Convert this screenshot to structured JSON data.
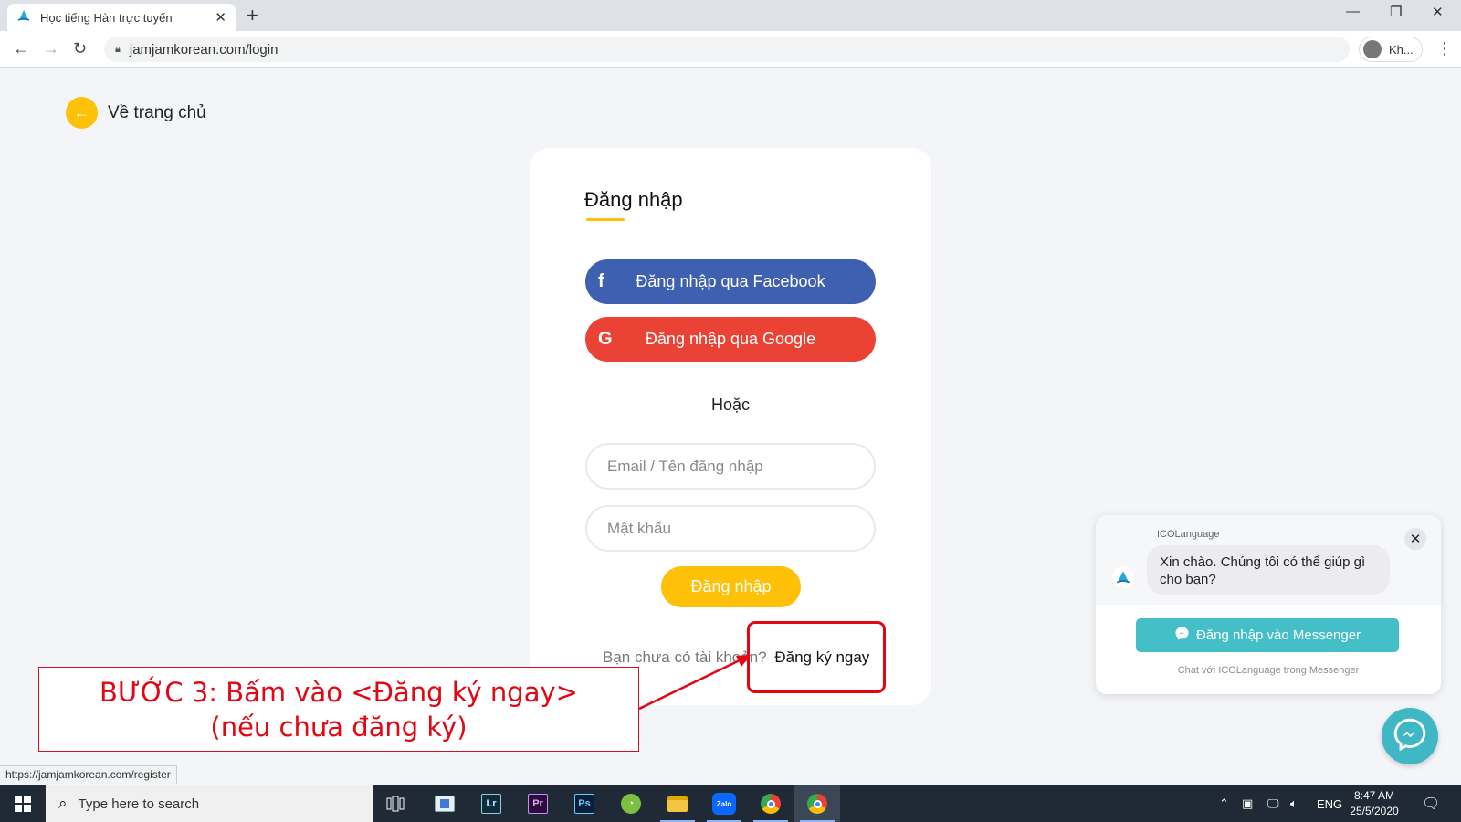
{
  "browser": {
    "tab_title": "Học tiếng Hàn trực tuyến",
    "url": "jamjamkorean.com/login",
    "profile_label": "Kh...",
    "status_url": "https://jamjamkorean.com/register"
  },
  "page": {
    "back_label": "Về trang chủ",
    "title": "Đăng nhập",
    "facebook_btn": "Đăng nhập qua Facebook",
    "google_btn": "Đăng nhập qua Google",
    "or_text": "Hoặc",
    "email_placeholder": "Email / Tên đăng nhập",
    "password_placeholder": "Mật khẩu",
    "login_btn": "Đăng nhập",
    "signup_prompt": "Bạn chưa có tài khoản?",
    "signup_link": "Đăng ký ngay",
    "accent_color": "#ffc107",
    "facebook_color": "#3f60b0",
    "google_color": "#ea4335"
  },
  "annotation": {
    "line1": "BƯỚC 3: Bấm vào <Đăng ký ngay>",
    "line2": "(nếu chưa đăng ký)",
    "color": "#e30613"
  },
  "chat": {
    "brand": "ICOLanguage",
    "greeting": "Xin chào. Chúng tôi có thể giúp gì cho bạn?",
    "messenger_btn": "Đăng nhập vào Messenger",
    "footer": "Chat với ICOLanguage trong Messenger",
    "color": "#44bec7"
  },
  "taskbar": {
    "search_placeholder": "Type here to search",
    "apps": [
      "task-view",
      "app-window",
      "lightroom",
      "premiere",
      "photoshop",
      "coccoc",
      "file-explorer",
      "zalo",
      "chrome-alt",
      "chrome"
    ],
    "app_labels": {
      "lightroom": "Lr",
      "premiere": "Pr",
      "photoshop": "Ps",
      "zalo": "Zalo"
    },
    "language": "ENG",
    "time": "8:47 AM",
    "date": "25/5/2020"
  }
}
